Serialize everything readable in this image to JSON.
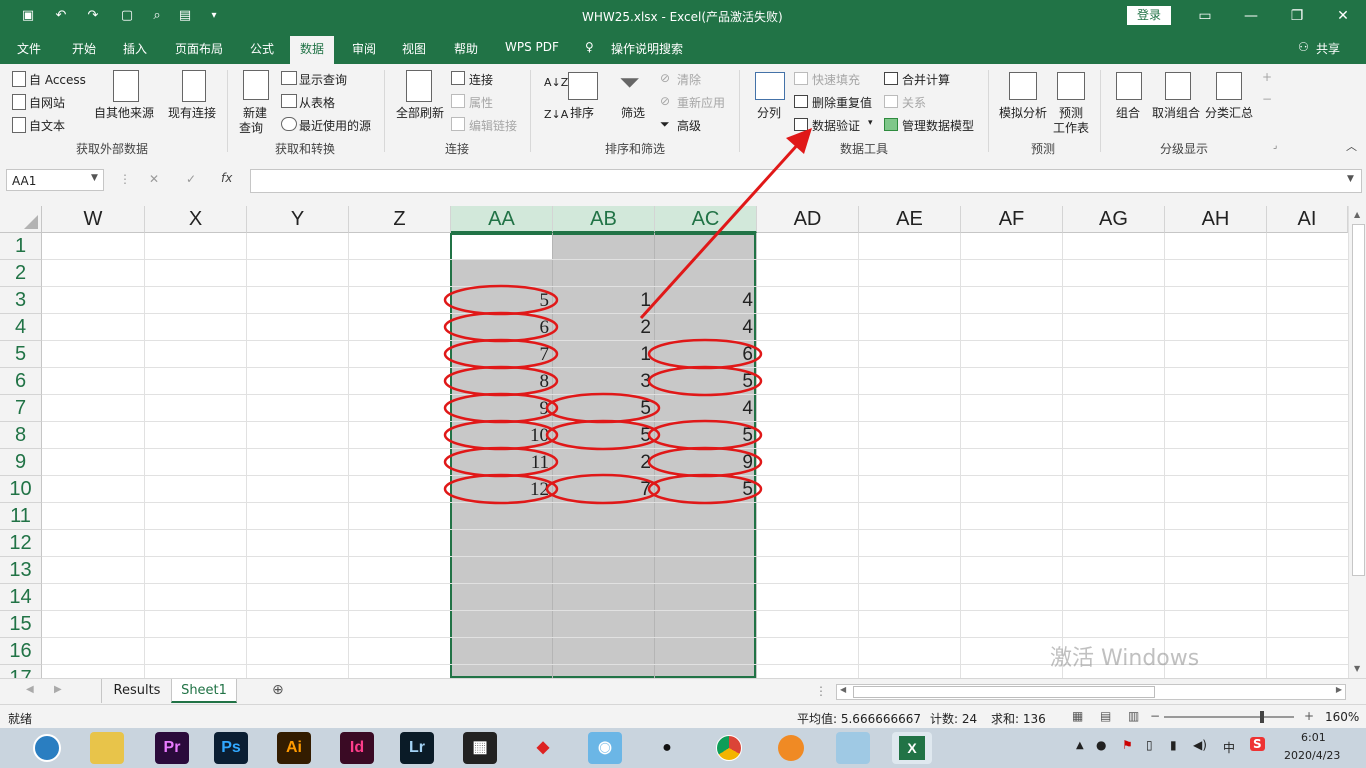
{
  "window": {
    "title": "WHW25.xlsx  -  Excel(产品激活失败)",
    "login_label": "登录",
    "minimize_icon": "minimize-icon",
    "maximize_icon": "restore-icon",
    "close_icon": "close-icon"
  },
  "ribbon_tabs": [
    "文件",
    "开始",
    "插入",
    "页面布局",
    "公式",
    "数据",
    "审阅",
    "视图",
    "帮助",
    "WPS PDF"
  ],
  "ribbon_active_tab": "数据",
  "tell_me": "操作说明搜索",
  "share": "共享",
  "ribbon": {
    "get_external": {
      "label": "获取外部数据",
      "access": "自 Access",
      "web": "自网站",
      "text": "自文本",
      "other_sources": "自其他来源",
      "existing": "现有连接"
    },
    "get_transform": {
      "label": "获取和转换",
      "new_query_1": "新建",
      "new_query_2": "查询",
      "show_queries": "显示查询",
      "from_table": "从表格",
      "recent_sources": "最近使用的源"
    },
    "connections": {
      "label": "连接",
      "refresh_all": "全部刷新",
      "connections": "连接",
      "properties": "属性",
      "edit_links": "编辑链接"
    },
    "sort_filter": {
      "label": "排序和筛选",
      "sort": "排序",
      "filter": "筛选",
      "clear": "清除",
      "reapply": "重新应用",
      "advanced": "高级"
    },
    "data_tools": {
      "label": "数据工具",
      "split": "分列",
      "flash_fill": "快速填充",
      "remove_dup": "删除重复值",
      "validation": "数据验证",
      "consolidate": "合并计算",
      "relations": "关系",
      "manage_model": "管理数据模型"
    },
    "forecast": {
      "label": "预测",
      "whatif": "模拟分析",
      "sheet_1": "预测",
      "sheet_2": "工作表"
    },
    "outline": {
      "label": "分级显示",
      "group": "组合",
      "ungroup": "取消组合",
      "subtotal": "分类汇总"
    }
  },
  "formula_bar": {
    "name_box": "AA1",
    "cancel_icon": "cancel-icon",
    "enter_icon": "enter-icon",
    "fx": "fx",
    "formula": ""
  },
  "columns": [
    "W",
    "X",
    "Y",
    "Z",
    "AA",
    "AB",
    "AC",
    "AD",
    "AE",
    "AF",
    "AG",
    "AH",
    "AI"
  ],
  "rows": [
    "1",
    "2",
    "3",
    "4",
    "5",
    "6",
    "7",
    "8",
    "9",
    "10",
    "11",
    "12",
    "13",
    "14",
    "15",
    "16",
    "17"
  ],
  "cells": {
    "AA": [
      "",
      "",
      "5",
      "6",
      "7",
      "8",
      "9",
      "10",
      "11",
      "12"
    ],
    "AB": [
      "",
      "",
      "1",
      "2",
      "1",
      "3",
      "5",
      "5",
      "2",
      "7"
    ],
    "AC": [
      "",
      "",
      "4",
      "4",
      "6",
      "5",
      "4",
      "5",
      "9",
      "5"
    ]
  },
  "sheets": [
    "Results",
    "Sheet1"
  ],
  "active_sheet": "Sheet1",
  "status": {
    "ready": "就绪",
    "average": "平均值: 5.666666667",
    "count": "计数: 24",
    "sum": "求和: 136",
    "zoom": "160%"
  },
  "taskbar": {
    "apps": [
      "Pr",
      "Ps",
      "Ai",
      "Id",
      "Lr"
    ],
    "ime": "中",
    "time": "6:01",
    "date": "2020/4/23"
  },
  "watermark": "激活 Windows",
  "colors": {
    "excel_green": "#217346",
    "selection_gray": "#c8c8c8",
    "annotation_red": "#e01818"
  }
}
